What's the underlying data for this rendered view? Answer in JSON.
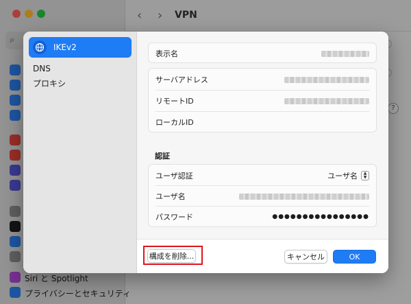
{
  "background": {
    "title": "VPN",
    "sidebar_visible_items": [
      "Siri と Spotlight",
      "プライバシーとセキュリティ"
    ]
  },
  "sheet": {
    "sidebar": {
      "items": [
        {
          "label": "IKEv2",
          "selected": true
        },
        {
          "label": "DNS",
          "selected": false
        },
        {
          "label": "プロキシ",
          "selected": false
        }
      ]
    },
    "general": {
      "display_name_label": "表示名",
      "server_address_label": "サーバアドレス",
      "remote_id_label": "リモートID",
      "local_id_label": "ローカルID"
    },
    "auth": {
      "section_title": "認証",
      "user_auth_label": "ユーザ認証",
      "user_auth_value": "ユーザ名",
      "username_label": "ユーザ名",
      "password_label": "パスワード",
      "password_mask": "●●●●●●●●●●●●●●●●"
    },
    "footer": {
      "delete_label": "構成を削除...",
      "cancel_label": "キャンセル",
      "ok_label": "OK"
    }
  },
  "colors": {
    "accent": "#1e7cf5",
    "highlight": "#e0131b"
  }
}
